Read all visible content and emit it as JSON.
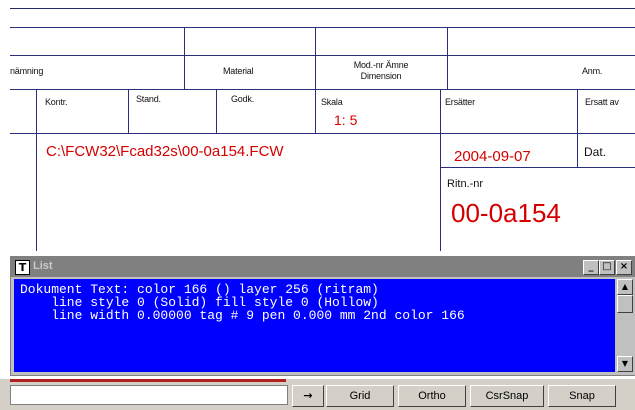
{
  "drawing": {
    "benamning": "nämning",
    "material": "Material",
    "modnr_line1": "Mod.-nr Ämne",
    "modnr_line2": "Dimension",
    "anm": "Anm.",
    "kontr": "Kontr.",
    "stand": "Stand.",
    "godk": "Godk.",
    "skala_label": "Skala",
    "skala_value": "1: 5",
    "ersatter": "Ersätter",
    "ersatt_av": "Ersatt av",
    "file_path": "C:\\FCW32\\Fcad32s\\00-0a154.FCW",
    "date_value": "2004-09-07",
    "dat_label": "Dat.",
    "ritnr_label": "Ritn.-nr",
    "ritnr_value": "00-0a154"
  },
  "list_window": {
    "icon": "T",
    "title": "List",
    "minimize": "_",
    "maximize": "□",
    "close": "×",
    "lines": [
      "Dokument Text: color 166 () layer 256 (ritram)",
      "    line style 0 (Solid) fill style 0 (Hollow)",
      "    line width 0.00000 tag # 9 pen 0.000 mm 2nd color 166"
    ],
    "scroll_up": "▲",
    "scroll_down": "▼"
  },
  "statusbar": {
    "command_value": "",
    "arrow_icon": "→",
    "grid": "Grid",
    "ortho": "Ortho",
    "csrsnap": "CsrSnap",
    "snap": "Snap"
  }
}
